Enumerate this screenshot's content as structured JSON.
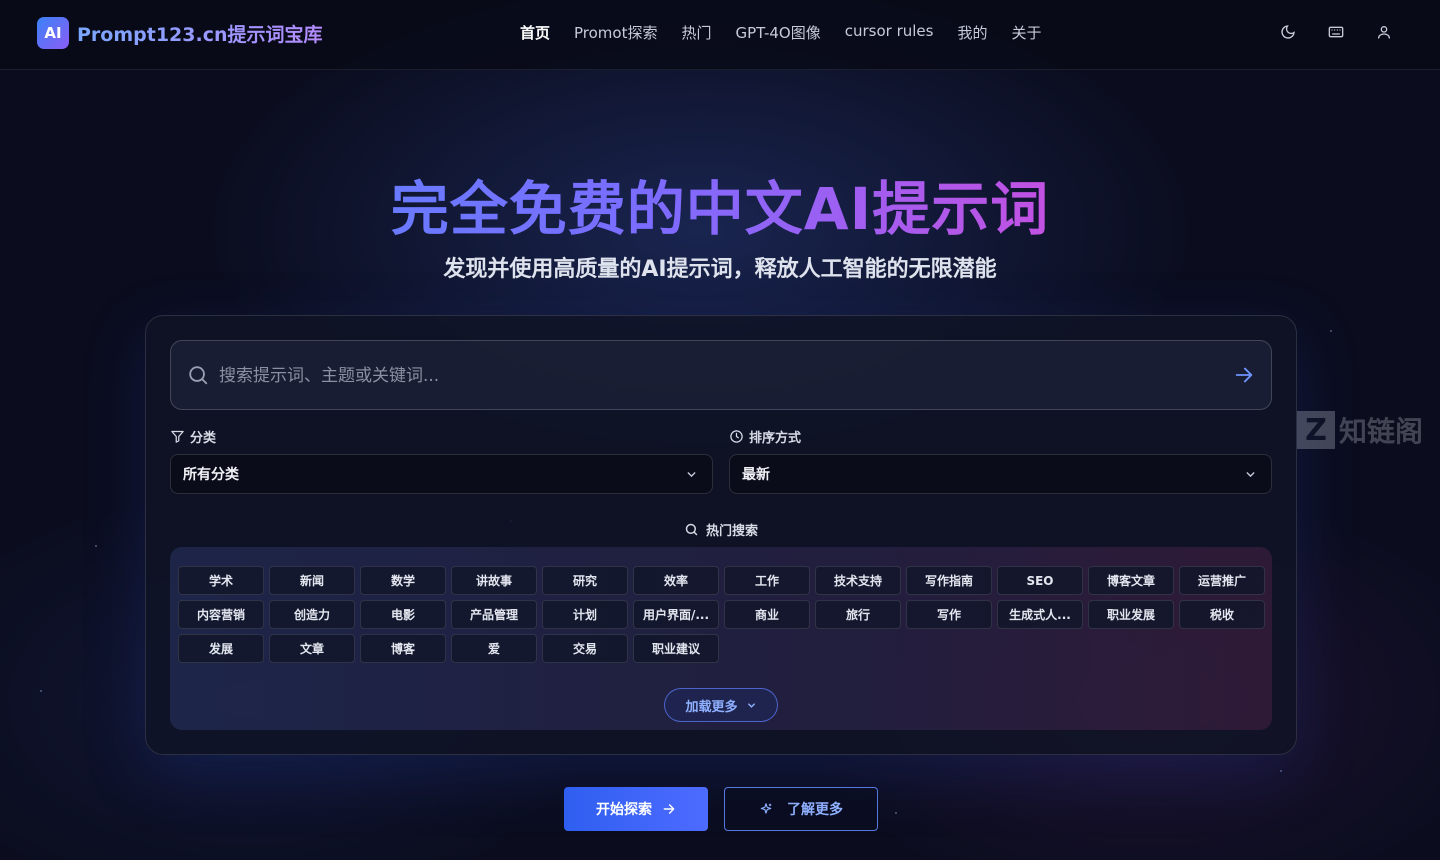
{
  "header": {
    "logo_badge": "AI",
    "logo_text": "Prompt123.cn提示词宝库",
    "nav": [
      {
        "label": "首页",
        "active": true
      },
      {
        "label": "Promot探索",
        "active": false
      },
      {
        "label": "热门",
        "active": false
      },
      {
        "label": "GPT-4O图像",
        "active": false
      },
      {
        "label": "cursor rules",
        "active": false
      },
      {
        "label": "我的",
        "active": false
      },
      {
        "label": "关于",
        "active": false
      }
    ],
    "icons": [
      "moon-icon",
      "keyboard-icon",
      "user-icon"
    ]
  },
  "hero": {
    "title": "完全免费的中文AI提示词",
    "subtitle": "发现并使用高质量的AI提示词，释放人工智能的无限潜能"
  },
  "search": {
    "placeholder": "搜索提示词、主题或关键词...",
    "value": ""
  },
  "filters": {
    "category_label": "分类",
    "category_value": "所有分类",
    "sort_label": "排序方式",
    "sort_value": "最新"
  },
  "hot": {
    "label": "热门搜索",
    "tags": [
      "学术",
      "新闻",
      "数学",
      "讲故事",
      "研究",
      "效率",
      "工作",
      "技术支持",
      "写作指南",
      "SEO",
      "博客文章",
      "运营推广",
      "内容营销",
      "创造力",
      "电影",
      "产品管理",
      "计划",
      "用户界面/...",
      "商业",
      "旅行",
      "写作",
      "生成式人...",
      "职业发展",
      "税收",
      "发展",
      "文章",
      "博客",
      "爱",
      "交易",
      "职业建议"
    ],
    "load_more": "加载更多"
  },
  "cta": {
    "primary": "开始探索",
    "secondary": "了解更多"
  },
  "watermark": {
    "letter": "Z",
    "text": "知链阁"
  },
  "colors": {
    "accent": "#4d6bff",
    "background": "#0b0d1f",
    "title_gradient": [
      "#4f8fff",
      "#7b6cff",
      "#c84fe0",
      "#ff4fa8"
    ]
  }
}
